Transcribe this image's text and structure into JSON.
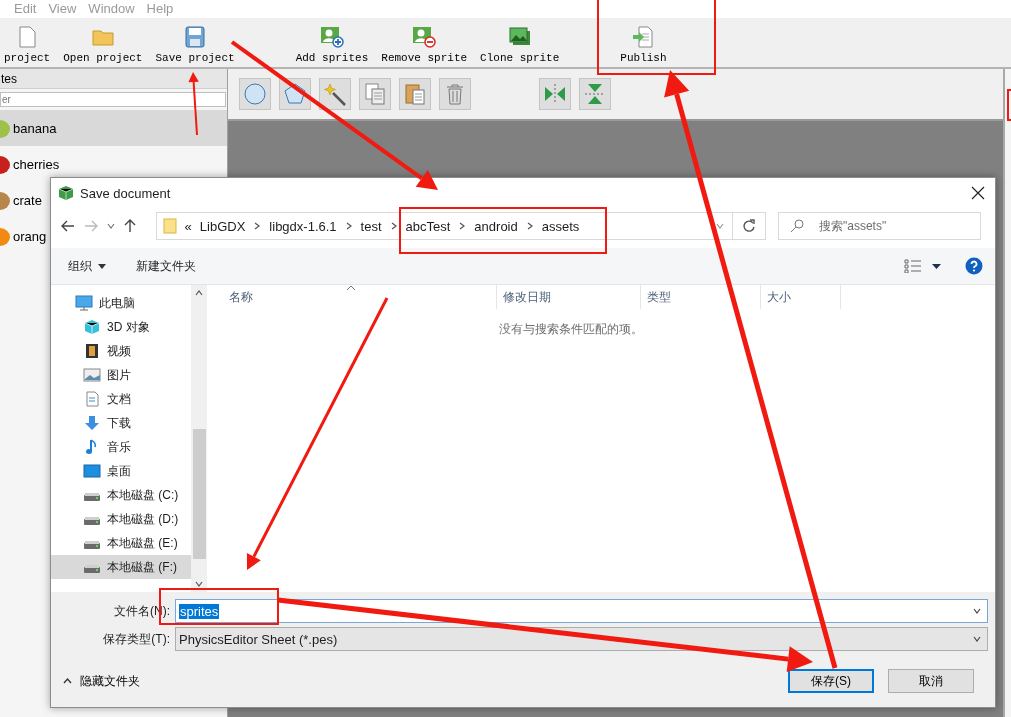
{
  "menu": [
    "Edit",
    "View",
    "Window",
    "Help"
  ],
  "toolbar": {
    "groups": [
      [
        "project",
        "Open project",
        "Save project"
      ],
      [
        "Add sprites",
        "Remove sprite",
        "Clone sprite"
      ],
      [
        "Publish"
      ]
    ]
  },
  "sprites_panel": {
    "title": "tes",
    "filter": {
      "placeholder": "er"
    },
    "items": [
      {
        "name": "banana",
        "selected": true
      },
      {
        "name": "cherries",
        "selected": false
      },
      {
        "name": "crate",
        "selected": false
      },
      {
        "name": "orang",
        "selected": false
      }
    ]
  },
  "dialog": {
    "title": "Save document",
    "address": {
      "overflow": "«",
      "parts": [
        "LibGDX",
        "libgdx-1.6.1",
        "test",
        "abcTest",
        "android",
        "assets"
      ]
    },
    "search": {
      "placeholder": "搜索\"assets\""
    },
    "commands": [
      {
        "label": "组织",
        "menu": true
      },
      {
        "label": "新建文件夹",
        "menu": false
      }
    ],
    "navigation": [
      {
        "label": "此电脑",
        "selected": false,
        "children": [
          {
            "label": "3D 对象",
            "selected": false
          },
          {
            "label": "视频",
            "selected": false
          },
          {
            "label": "图片",
            "selected": false
          },
          {
            "label": "文档",
            "selected": false
          },
          {
            "label": "下载",
            "selected": false
          },
          {
            "label": "音乐",
            "selected": false
          },
          {
            "label": "桌面",
            "selected": false
          },
          {
            "label": "本地磁盘 (C:)",
            "selected": false
          },
          {
            "label": "本地磁盘 (D:)",
            "selected": false
          },
          {
            "label": "本地磁盘 (E:)",
            "selected": false
          },
          {
            "label": "本地磁盘 (F:)",
            "selected": true
          }
        ]
      }
    ],
    "columns": [
      "名称",
      "修改日期",
      "类型",
      "大小"
    ],
    "empty_message": "没有与搜索条件匹配的项。",
    "file_name": {
      "label": "文件名(N):",
      "value": "sprites",
      "selected": true
    },
    "file_type": {
      "label": "保存类型(T):",
      "value": "PhysicsEditor Sheet (*.pes)"
    },
    "hide_folders": "隐藏文件夹",
    "buttons": [
      {
        "label": "保存(S)",
        "default": true
      },
      {
        "label": "取消",
        "default": false
      }
    ]
  }
}
